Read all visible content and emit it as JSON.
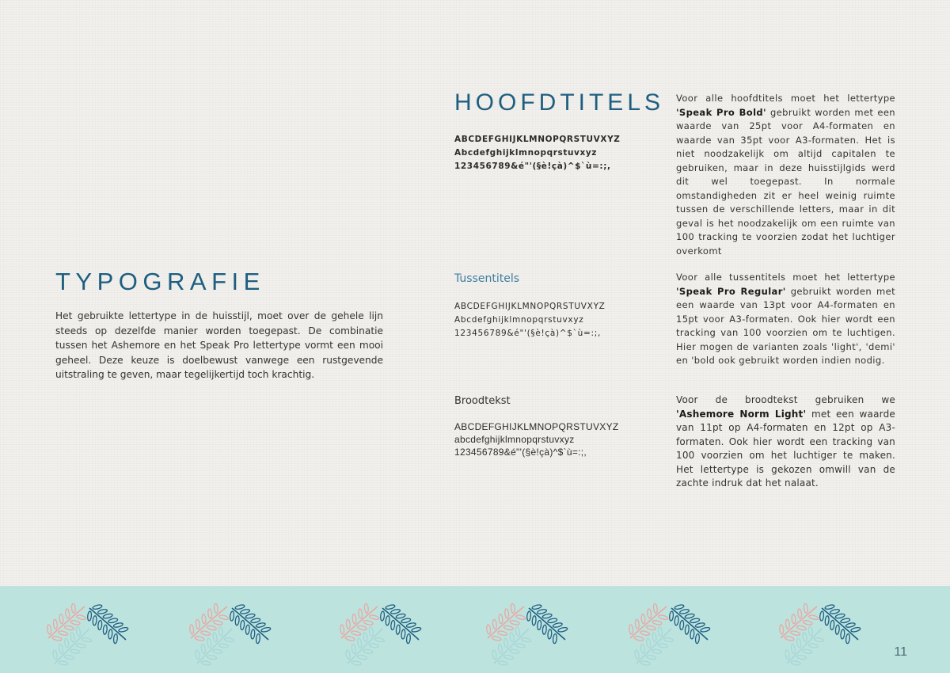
{
  "left": {
    "title": "TYPOGRAFIE",
    "intro": "Het gebruikte lettertype in de huisstijl, moet over de gehele lijn steeds op dezelfde manier worden toegepast. De combinatie tussen het Ashemore en het Speak Pro lettertype vormt een mooi geheel. Deze keuze is doelbewust vanwege een rustgevende uitstraling te geven, maar tegelijkertijd toch krachtig."
  },
  "sections": {
    "hoofdtitels": {
      "title": "HOOFDTITELS",
      "sample": [
        "ABCDEFGHIJKLMNOPQRSTUVXYZ",
        "Abcdefghijklmnopqrstuvxyz",
        "123456789&é\"'(§è!çà)^$`ù=:;,"
      ],
      "desc_pre": "Voor alle hoofdtitels moet het lettertype ",
      "desc_bold": "'Speak Pro Bold'",
      "desc_post": " gebruikt worden met een waarde van 25pt voor A4-formaten en waarde van 35pt voor A3-formaten. Het is niet noodzakelijk om altijd capitalen te gebruiken, maar in deze huisstijlgids werd dit wel toegepast. In normale omstandigheden zit er heel weinig ruimte tussen de verschillende letters, maar in dit geval is het noodzakelijk om een ruimte van 100 tracking te voorzien zodat het luchtiger overkomt"
    },
    "tussentitels": {
      "title": "Tussentitels",
      "sample": [
        "ABCDEFGHIJKLMNOPQRSTUVXYZ",
        "Abcdefghijklmnopqrstuvxyz",
        "123456789&é\"'(§è!çà)^$`ù=:;,"
      ],
      "desc_pre": "Voor alle tussentitels moet het lettertype ",
      "desc_bold": "'Speak Pro Regular'",
      "desc_post": " gebruikt worden met een waarde van 13pt voor A4-formaten en 15pt voor A3-formaten. Ook hier wordt een tracking van 100 voorzien om te luchtigen. Hier mogen de varianten zoals 'light', 'demi' en 'bold ook gebruikt worden indien nodig."
    },
    "broodtekst": {
      "title": "Broodtekst",
      "sample": [
        "ABCDEFGHIJKLMNOPQRSTUVXYZ",
        "abcdefghijklmnopqrstuvxyz",
        "123456789&é\"'(§è!çà)^$`ù=:;,"
      ],
      "desc_pre": "Voor de broodtekst gebruiken we ",
      "desc_bold": "'Ashemore Norm Light'",
      "desc_post": " met een waarde van 11pt op A4-formaten en 12pt op A3-formaten. Ook hier wordt een tracking van 100 voorzien om het luchtiger te maken. Het lettertype is gekozen omwill van de zachte indruk dat het nalaat."
    }
  },
  "footer": {
    "page_number": "11",
    "background": "#bde3df",
    "leaf_colors": [
      "#e9a8a3",
      "#a7d6d4",
      "#1f5f82"
    ],
    "leaf_icon": "leaf-branch-icon"
  },
  "colors": {
    "heading": "#1e5f80",
    "subheading": "#3f7ea0",
    "text": "#333333",
    "paper": "#f1f0ec"
  }
}
